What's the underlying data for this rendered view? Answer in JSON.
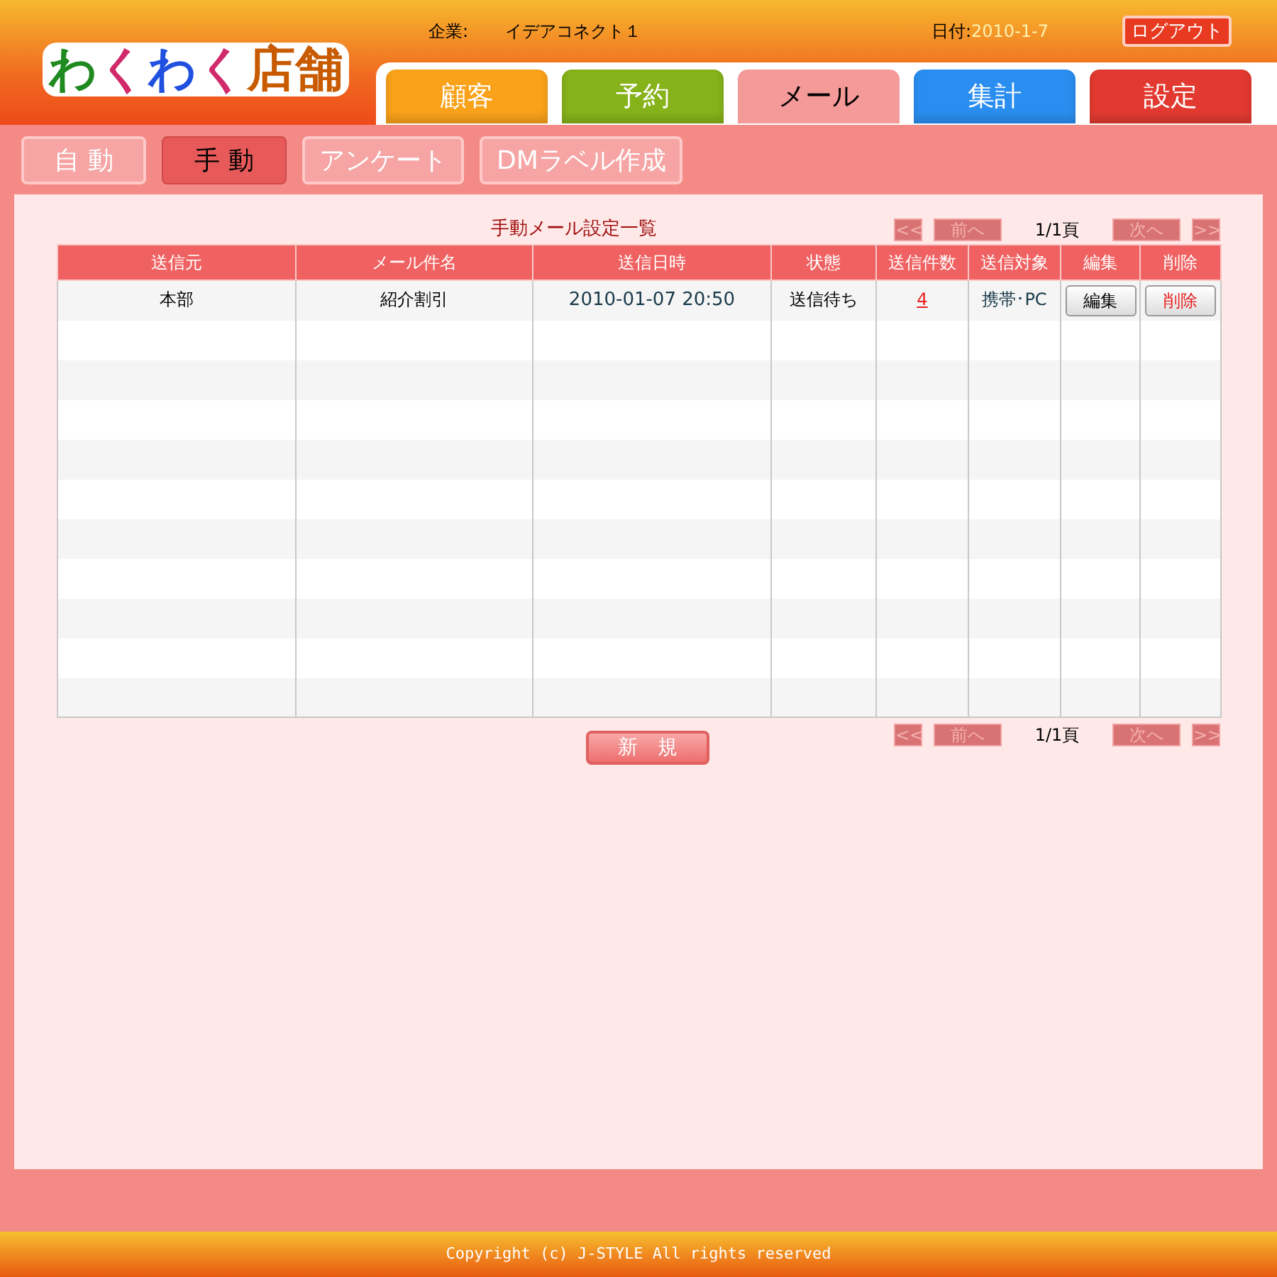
{
  "logo": [
    {
      "text": "わ",
      "color": "#1f8a1f"
    },
    {
      "text": "く",
      "color": "#d02a6a"
    },
    {
      "text": "わ",
      "color": "#2050e0"
    },
    {
      "text": "く",
      "color": "#d02a6a"
    },
    {
      "text": "店",
      "color": "#c85a00"
    },
    {
      "text": "舗",
      "color": "#c85a00"
    }
  ],
  "header": {
    "company_label": "企業:",
    "company": "イデアコネクト１",
    "date_label": "日付:",
    "date": "2010-1-7",
    "logout": "ログアウト"
  },
  "tabs": [
    {
      "label": "顧客",
      "selected": false,
      "color": "#f9a21a"
    },
    {
      "label": "予約",
      "selected": false,
      "color": "#86b21a"
    },
    {
      "label": "メール",
      "selected": true,
      "color": "#f49a98"
    },
    {
      "label": "集計",
      "selected": false,
      "color": "#2a8ef0"
    },
    {
      "label": "設定",
      "selected": false,
      "color": "#e23a30"
    }
  ],
  "sub_tabs": [
    {
      "label": "自 動",
      "selected": false
    },
    {
      "label": "手 動",
      "selected": true
    },
    {
      "label": "アンケート",
      "selected": false
    },
    {
      "label": "DMラベル作成",
      "selected": false
    }
  ],
  "list_title": "手動メール設定一覧",
  "pager_top": {
    "first": "<<",
    "prev": "前へ",
    "page": "1/1頁",
    "next": "次へ",
    "last": ">>",
    "disabled": true
  },
  "table": {
    "columns": [
      "送信元",
      "メール件名",
      "送信日時",
      "状態",
      "送信件数",
      "送信対象",
      "編集",
      "削除"
    ],
    "rows": [
      {
        "sender": "本部",
        "subject": "紹介割引",
        "datetime": "2010-01-07 20:50",
        "status": "送信待ち",
        "count": "4",
        "target": "携帯･PC",
        "edit": "編集",
        "delete": "削除"
      }
    ]
  },
  "new_button": "新　規",
  "pager_bottom": {
    "first": "<<",
    "prev": "前へ",
    "page": "1/1頁",
    "next": "次へ",
    "last": ">>",
    "disabled": true
  },
  "footer": "Copyright (c) J-STYLE All rights reserved"
}
